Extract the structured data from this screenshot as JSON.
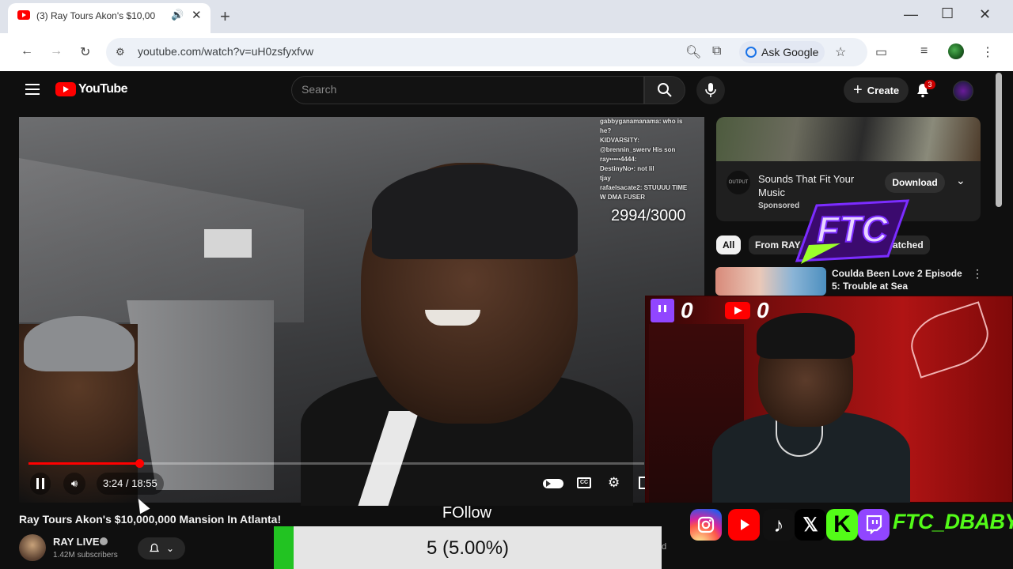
{
  "browser": {
    "tab_title": "(3) Ray Tours Akon's $10,00",
    "url": "youtube.com/watch?v=uH0zsfyxfvw",
    "ask_google": "Ask Google"
  },
  "youtube": {
    "logo_text": "YouTube",
    "search_placeholder": "Search",
    "create_label": "Create",
    "notification_count": "3"
  },
  "video": {
    "current_time": "3:24",
    "duration": "18:55",
    "time_display": "3:24 / 18:55",
    "progress": 0.18,
    "chat_lines": [
      "gabbyganamanama: who is",
      "he?",
      "KIDVARSITY:",
      "@brennin_swerv His son",
      "ray•••••4444:",
      "DestinyNo•:        not lil",
      "tjay",
      "rafaelsacate2: STUUUU TIME",
      "                W DMA FUSER"
    ],
    "overlay_goal": "2994/3000"
  },
  "below_video": {
    "title": "Ray Tours Akon's $10,000,000 Mansion In Atlanta!",
    "channel_name": "RAY LIVE",
    "subscribers": "1.42M subscribers",
    "partial_text": "d"
  },
  "sidebar": {
    "ad": {
      "logo": "OUTPUT",
      "title": "Sounds That Fit Your Music",
      "sponsored": "Sponsored",
      "download": "Download"
    },
    "chips": [
      "All",
      "From RAY",
      "atched"
    ],
    "recommended": {
      "title": "Coulda Been Love 2 Episode 5: Trouble at Sea"
    }
  },
  "stream_overlay": {
    "ftc_logo": "FTC",
    "twitch_viewers": "0",
    "youtube_viewers": "0",
    "handle": "FTC_DBABY",
    "follow_label": "FOllow",
    "follow_goal_text": "5 (5.00%)",
    "follow_goal_progress": 0.05
  }
}
